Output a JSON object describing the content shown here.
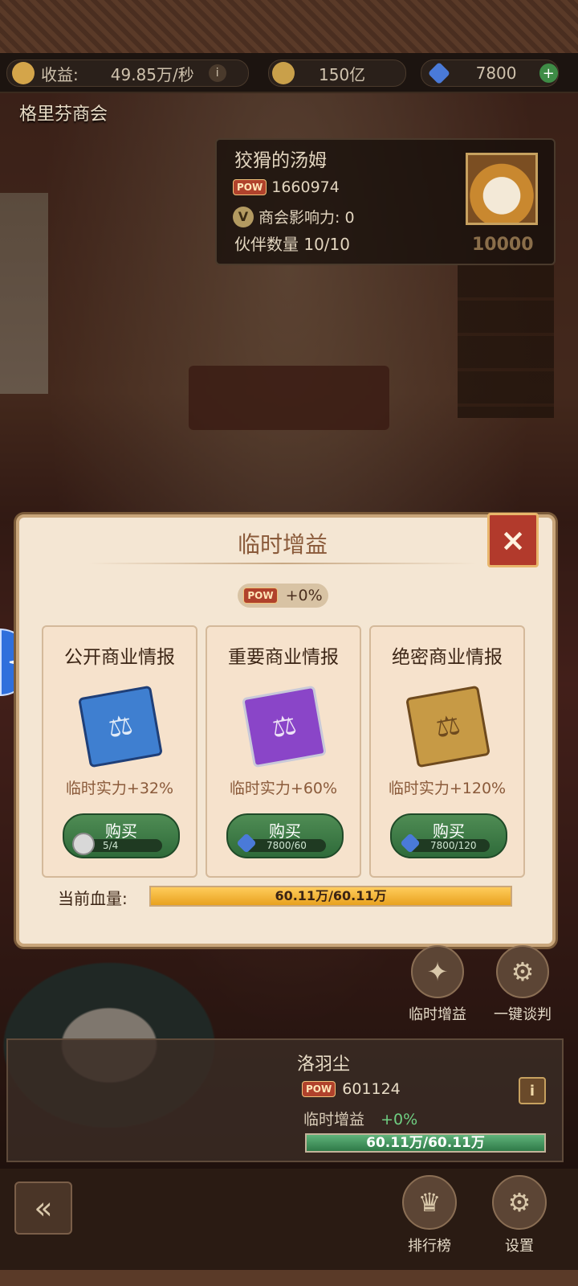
{
  "top": {
    "income_label": "收益:",
    "income_value": "49.85万/秒",
    "gold_value": "150亿",
    "gems_value": "7800"
  },
  "scene": {
    "place_name": "格里芬商会"
  },
  "npc": {
    "name": "狡猾的汤姆",
    "pow_tag": "POW",
    "power": "1660974",
    "influence_icon": "V",
    "influence": "商会影响力: 0",
    "partners": "伙伴数量  10/10",
    "bounty": "10000"
  },
  "modal": {
    "title": "临时增益",
    "close_label": "×",
    "pow_tag": "POW",
    "pow_bonus": "+0%",
    "cards": [
      {
        "title": "公开商业情报",
        "book_color": "#3f7fd0",
        "effect": "临时实力+32%",
        "buy_label": "购买",
        "cost": "5/4",
        "cost_icon": "silver-coin-icon"
      },
      {
        "title": "重要商业情报",
        "book_color": "#8a45c8",
        "effect": "临时实力+60%",
        "buy_label": "购买",
        "cost": "7800/60",
        "cost_icon": "diamond-icon"
      },
      {
        "title": "绝密商业情报",
        "book_color": "#c79a45",
        "effect": "临时实力+120%",
        "buy_label": "购买",
        "cost": "7800/120",
        "cost_icon": "diamond-icon"
      }
    ],
    "hp_label": "当前血量:",
    "hp_text": "60.11万/60.11万",
    "hp_fraction": 1.0
  },
  "quick": {
    "buff_label": "临时增益",
    "negotiate_label": "一键谈判"
  },
  "player": {
    "name": "洛羽尘",
    "pow_tag": "POW",
    "power": "601124",
    "buff_label": "临时增益",
    "buff_value": "+0%",
    "hp_text": "60.11万/60.11万",
    "hp_fraction": 1.0,
    "info_label": "i"
  },
  "nav": {
    "ranking_label": "排行榜",
    "settings_label": "设置"
  },
  "colors": {
    "accent_red": "#b23a2c",
    "button_green": "#2f6b3a",
    "hp_gold": "#e8a21f"
  }
}
